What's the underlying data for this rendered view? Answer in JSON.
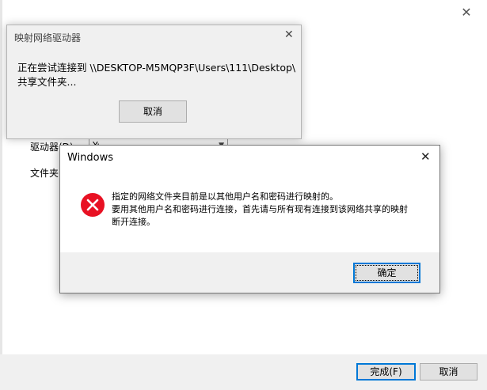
{
  "background_window": {
    "drive_label": "驱动器(D):",
    "drive_value": "Y:",
    "folder_label": "文件夹",
    "finish_button": "完成(F)",
    "cancel_button": "取消"
  },
  "progress_dialog": {
    "title": "映射网络驱动器",
    "message": "正在尝试连接到 \\\\DESKTOP-M5MQP3F\\Users\\111\\Desktop\\\n共享文件夹...",
    "cancel_button": "取消"
  },
  "error_dialog": {
    "title": "Windows",
    "icon": "error-icon",
    "message_lines": [
      "指定的网络文件夹目前是以其他用户名和密码进行映射的。",
      "要用其他用户名和密码进行连接，首先请与所有现有连接到该网络共享的映射",
      "断开连接。"
    ],
    "ok_button": "确定",
    "accent_color": "#0078d7",
    "icon_color": "#e81123"
  }
}
